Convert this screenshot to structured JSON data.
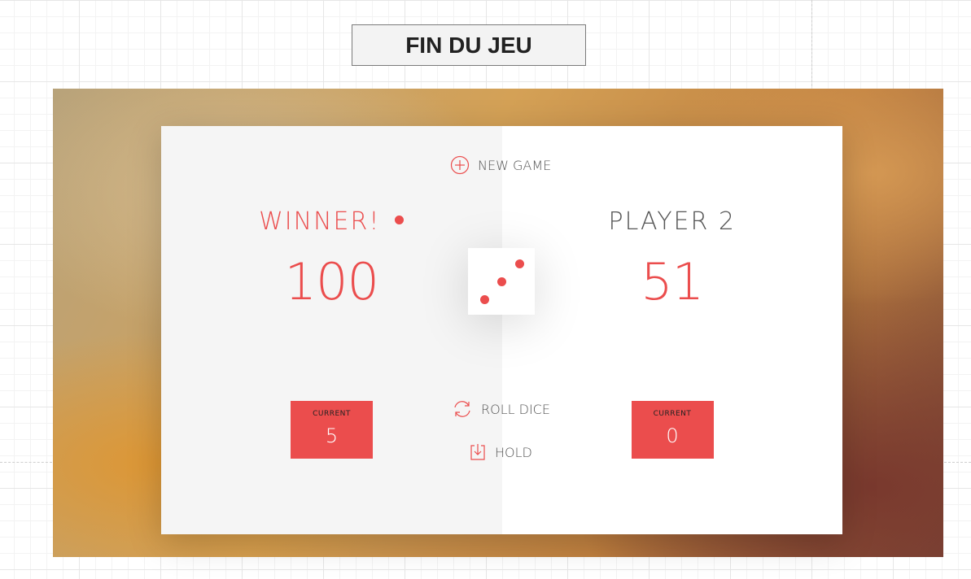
{
  "page_title": "FIN DU JEU",
  "game": {
    "new_game_label": "NEW GAME",
    "roll_dice_label": "ROLL DICE",
    "hold_label": "HOLD",
    "dice_value": 3,
    "players": [
      {
        "name": "WINNER!",
        "score": "100",
        "current_label": "CURRENT",
        "current_score": "5",
        "active": true
      },
      {
        "name": "PLAYER 2",
        "score": "51",
        "current_label": "CURRENT",
        "current_score": "0",
        "active": false
      }
    ]
  },
  "colors": {
    "accent": "#eb4d4d",
    "panel_left": "#f5f5f5",
    "panel_right": "#ffffff",
    "text": "#555555"
  },
  "icons": {
    "new_game": "plus-circle-icon",
    "roll_dice": "refresh-icon",
    "hold": "download-icon"
  }
}
